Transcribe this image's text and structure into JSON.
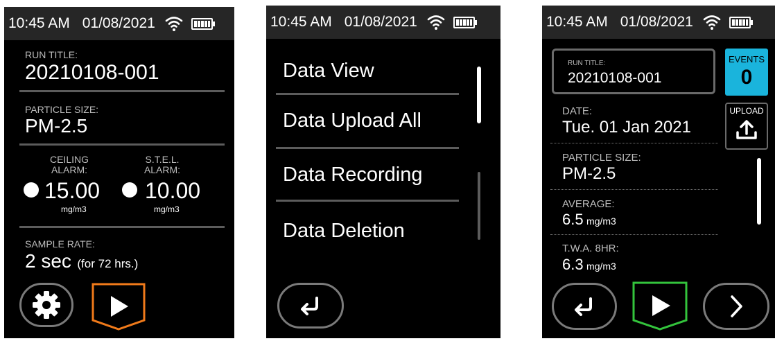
{
  "status": {
    "time": "10:45 AM",
    "date": "01/08/2021"
  },
  "screen1": {
    "run_title_label": "RUN TITLE:",
    "run_title": "20210108-001",
    "particle_size_label": "PARTICLE SIZE:",
    "particle_size": "PM-2.5",
    "ceiling_label_1": "CEILING",
    "ceiling_label_2": "ALARM:",
    "ceiling_value": "15.00",
    "ceiling_unit": "mg/m3",
    "stel_label_1": "S.T.E.L.",
    "stel_label_2": "ALARM:",
    "stel_value": "10.00",
    "stel_unit": "mg/m3",
    "sample_rate_label": "SAMPLE RATE:",
    "sample_rate_value": "2 sec",
    "sample_rate_note": "(for 72 hrs.)",
    "play_color": "#f07a1a"
  },
  "screen2": {
    "menu": [
      "Data View",
      "Data Upload All",
      "Data Recording",
      "Data Deletion"
    ]
  },
  "screen3": {
    "run_title_label": "RUN TITLE:",
    "run_title": "20210108-001",
    "events_label": "EVENTS",
    "events_count": "0",
    "upload_label": "UPLOAD",
    "date_label": "DATE:",
    "date_value": "Tue. 01 Jan 2021",
    "particle_size_label": "PARTICLE SIZE:",
    "particle_size": "PM-2.5",
    "average_label": "AVERAGE:",
    "average_value": "6.5",
    "average_unit": "mg/m3",
    "twa_label": "T.W.A. 8HR:",
    "twa_value": "6.3",
    "twa_unit": "mg/m3",
    "events_color": "#1ab4dc",
    "play_color": "#33c43c"
  }
}
